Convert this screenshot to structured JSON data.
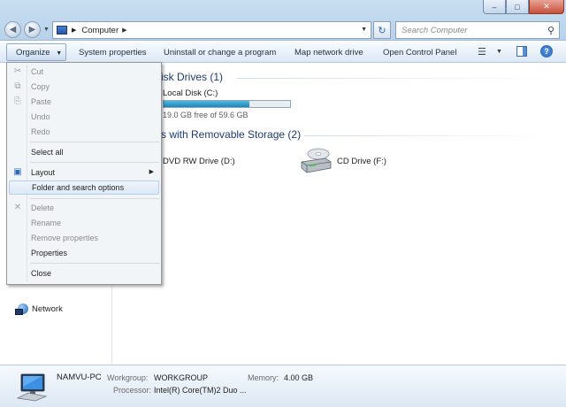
{
  "address": {
    "location": "Computer"
  },
  "search": {
    "placeholder": "Search Computer"
  },
  "toolbar": {
    "organize": "Organize",
    "system_properties": "System properties",
    "uninstall": "Uninstall or change a program",
    "map_drive": "Map network drive",
    "control_panel": "Open Control Panel"
  },
  "organize_menu": {
    "cut": "Cut",
    "copy": "Copy",
    "paste": "Paste",
    "undo": "Undo",
    "redo": "Redo",
    "select_all": "Select all",
    "layout": "Layout",
    "folder_options": "Folder and search options",
    "delete": "Delete",
    "rename": "Rename",
    "remove_properties": "Remove properties",
    "properties": "Properties",
    "close": "Close"
  },
  "nav": {
    "network": "Network"
  },
  "groups": {
    "hard_disks": "isk Drives (1)",
    "removable": "s with Removable Storage (2)"
  },
  "drives": {
    "c_name": "Local Disk (C:)",
    "c_space": "19.0 GB free of 59.6 GB",
    "c_used_fraction": 0.68,
    "d_name": "DVD RW Drive (D:)",
    "f_name": "CD Drive (F:)"
  },
  "details": {
    "pc_name": "NAMVU-PC",
    "workgroup_label": "Workgroup:",
    "workgroup": "WORKGROUP",
    "memory_label": "Memory:",
    "memory": "4.00 GB",
    "processor_label": "Processor:",
    "processor": "Intel(R) Core(TM)2 Duo ..."
  },
  "colors": {
    "accent": "#1e3a73",
    "progress": "#1e86b4",
    "toolbar": "#dce8f5"
  },
  "icons": [
    "back-icon",
    "forward-icon",
    "computer-icon",
    "refresh-icon",
    "search-icon",
    "views-icon",
    "preview-pane-icon",
    "help-icon",
    "network-icon",
    "cd-drive-icon",
    "pc-icon"
  ]
}
